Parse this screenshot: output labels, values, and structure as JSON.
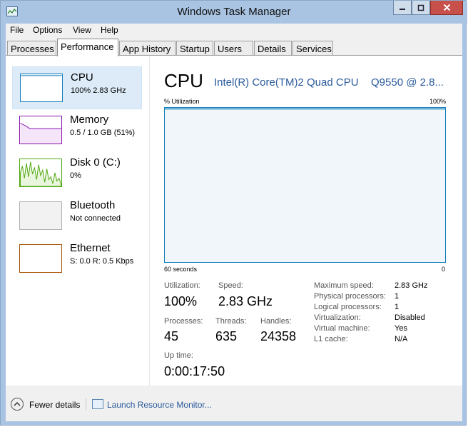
{
  "window": {
    "title": "Windows Task Manager"
  },
  "menu": [
    "File",
    "Options",
    "View",
    "Help"
  ],
  "tabs": [
    "Processes",
    "Performance",
    "App History",
    "Startup",
    "Users",
    "Details",
    "Services"
  ],
  "active_tab": "Performance",
  "sidebar": {
    "items": [
      {
        "name": "CPU",
        "detail": "100%  2.83 GHz",
        "color": "#117dbb"
      },
      {
        "name": "Memory",
        "detail": "0.5 / 1.0 GB (51%)",
        "color": "#8b12ae"
      },
      {
        "name": "Disk 0 (C:)",
        "detail": "0%",
        "color": "#4da60c"
      },
      {
        "name": "Bluetooth",
        "detail": "Not connected",
        "color": "#999999"
      },
      {
        "name": "Ethernet",
        "detail": "S: 0.0 R: 0.5 Kbps",
        "color": "#a74f01"
      }
    ]
  },
  "main": {
    "title": "CPU",
    "model": "Intel(R) Core(TM)2 Quad CPU",
    "model_speed": "Q9550  @ 2.8...",
    "graph": {
      "top_left": "% Utilization",
      "top_right": "100%",
      "bottom_left": "60 seconds",
      "bottom_right": "0",
      "utilization_percent": 100
    },
    "stats": {
      "utilization_label": "Utilization:",
      "utilization_value": "100%",
      "speed_label": "Speed:",
      "speed_value": "2.83 GHz",
      "processes_label": "Processes:",
      "processes_value": "45",
      "threads_label": "Threads:",
      "threads_value": "635",
      "handles_label": "Handles:",
      "handles_value": "24358",
      "uptime_label": "Up time:",
      "uptime_value": "0:00:17:50"
    },
    "details": [
      {
        "key": "Maximum speed:",
        "value": "2.83 GHz"
      },
      {
        "key": "Physical processors:",
        "value": "1"
      },
      {
        "key": "Logical processors:",
        "value": "1"
      },
      {
        "key": "Virtualization:",
        "value": "Disabled"
      },
      {
        "key": "Virtual machine:",
        "value": "Yes"
      },
      {
        "key": "L1 cache:",
        "value": "N/A"
      }
    ]
  },
  "footer": {
    "fewer_details": "Fewer details",
    "resource_monitor": "Launch Resource Monitor..."
  }
}
